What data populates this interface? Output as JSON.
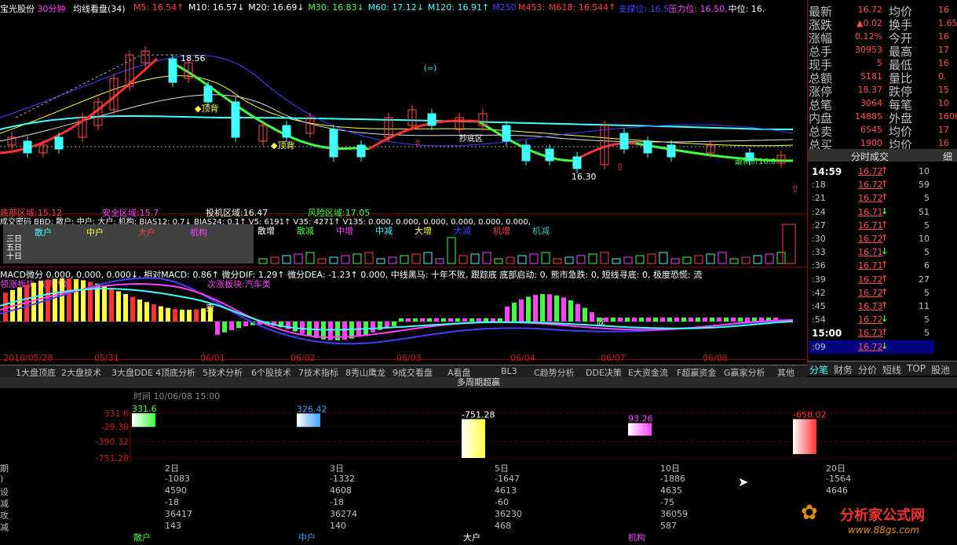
{
  "header": {
    "stock_name": "宝光股份",
    "period": "30分钟",
    "indicator": "均线看盘(34)",
    "ma_items": [
      {
        "label": "M5: 16.54↑",
        "color": "#ff4040"
      },
      {
        "label": "M10: 16.57↓",
        "color": "#ffffff"
      },
      {
        "label": "M20: 16.69↓",
        "color": "#ffffff"
      },
      {
        "label": "M30: 16.83↓",
        "color": "#40ff40"
      },
      {
        "label": "M60: 17.12↓",
        "color": "#40ffff"
      },
      {
        "label": "M120: 16.91↑",
        "color": "#40ffff"
      },
      {
        "label": "M250",
        "color": "#4040ff"
      },
      {
        "label": "M453:",
        "color": "#ff4040"
      },
      {
        "label": "M618: 16.544↑",
        "color": "#ff4040"
      },
      {
        "label": "支撑位: 16.5",
        "color": "#4040ff"
      },
      {
        "label": "压力位: 16.50,",
        "color": "#ff40ff"
      },
      {
        "label": "中位: 16.",
        "color": "#ffffff"
      }
    ]
  },
  "kline_annotations": {
    "high_price": "18.56",
    "low_price": "16.30",
    "top_divergence_1": "顶背",
    "top_divergence_2": "顶背",
    "sell_label": "抄底区",
    "cost_label": "最新价16.0",
    "bottom_zone": "底部区域:15.12",
    "safe_zone": "安全区域:15.7",
    "speculative_zone": "投机区域:16.47",
    "risk_zone": "风险区域:17.05"
  },
  "bbd": {
    "header": "成交密码 BBD: 散户: 中户: 大户: 机构: BIAS12: 0.7↓ BIAS24: 0.1↑ V5: 6191↑ V35: 4271↑ V135: 0.000, 0.000, 0.000, 0.000, 0.000, 0.000,",
    "legend": [
      "散户",
      "中户",
      "大户",
      "机构"
    ],
    "legend_colors": [
      "#40ffff",
      "#ffff40",
      "#ff4040",
      "#ff40ff"
    ],
    "periods": [
      "三日",
      "五日",
      "十日"
    ],
    "flow_labels": [
      "散增",
      "散减",
      "中增",
      "中减",
      "大增",
      "大减",
      "机增",
      "机减"
    ],
    "flow_colors": [
      "#ffffff",
      "#40ff40",
      "#ff40ff",
      "#40ffff",
      "#ffff40",
      "#4040ff",
      "#ff4040",
      "#40c0c0"
    ]
  },
  "macd": {
    "header": "MACD微分 0.000, 0.000, 0.000↓, 相对MACD: 0.86↑ 微分DIF: 1.29↑ 微分DEA: -1.23↑ 0.000, 中线黑马: 十年不败, 跟踪底 底部启动: 0, 熊市急跌: 0, 短线寻底: 0, 极度恐慌: 流",
    "strong_sector": "领涨板块:教育传媒",
    "second_sector": "次涨板块:汽车类",
    "sell_mark": "卖",
    "bottom_mark": "底"
  },
  "dates": [
    "2010/05/28",
    "05/31",
    "06/01",
    "06/02",
    "06/03",
    "06/04",
    "06/07",
    "06/08"
  ],
  "toolbar": [
    "1大盘顶底",
    "2大盘技术",
    "3大盘DDE",
    "4顶底分析",
    "5技术分析",
    "6个股技术",
    "7技术指标",
    "8秀山鹰龙",
    "9成交看盘",
    "A看盘",
    "BL3",
    "C趋势分析",
    "DDE决策",
    "E大资金流",
    "F超赢资金",
    "G赢家分析",
    "其他"
  ],
  "quote": {
    "rows": [
      {
        "l1": "最新",
        "v1": "16.72",
        "l2": "均价",
        "v2": "16"
      },
      {
        "l1": "涨跌",
        "v1": "▲0.02",
        "l2": "换手",
        "v2": "1.65"
      },
      {
        "l1": "涨幅",
        "v1": "0.12%",
        "l2": "今开",
        "v2": "16"
      },
      {
        "l1": "总手",
        "v1": "30953",
        "l2": "最高",
        "v2": "17"
      },
      {
        "l1": "现手",
        "v1": "5",
        "l2": "最低",
        "v2": "16"
      },
      {
        "l1": "总额",
        "v1": "5181",
        "l2": "量比",
        "v2": "0."
      },
      {
        "l1": "涨停",
        "v1": "18.37",
        "l2": "跌停",
        "v2": "15"
      },
      {
        "l1": "总笔",
        "v1": "3064",
        "l2": "每笔",
        "v2": "10"
      },
      {
        "l1": "内盘",
        "v1": "14885",
        "l2": "外盘",
        "v2": "1606"
      },
      {
        "l1": "总卖",
        "v1": "6545",
        "l2": "均价",
        "v2": "17"
      },
      {
        "l1": "总买",
        "v1": "1900",
        "l2": "均价",
        "v2": "16"
      }
    ],
    "ticks_title": "分时成交",
    "ticks_more": "细",
    "ticks": [
      {
        "t": "14:59",
        "p": "16.72",
        "v": "10",
        "a": "↑"
      },
      {
        "t": ":18",
        "p": "16.72",
        "v": "59",
        "a": "↑"
      },
      {
        "t": ":21",
        "p": "16.72",
        "v": "5",
        "a": "↑"
      },
      {
        "t": ":24",
        "p": "16.71",
        "v": "51",
        "a": "↓"
      },
      {
        "t": ":27",
        "p": "16.71",
        "v": "5",
        "a": "↑"
      },
      {
        "t": ":30",
        "p": "16.72",
        "v": "10",
        "a": "↑"
      },
      {
        "t": ":33",
        "p": "16.71",
        "v": "5",
        "a": "↓"
      },
      {
        "t": ":36",
        "p": "16.71",
        "v": "6",
        "a": "↑"
      },
      {
        "t": ":39",
        "p": "16.72",
        "v": "27",
        "a": "↑"
      },
      {
        "t": ":42",
        "p": "16.72",
        "v": "5",
        "a": "↑"
      },
      {
        "t": ":45",
        "p": "16.73",
        "v": "11",
        "a": "↑"
      },
      {
        "t": ":54",
        "p": "16.72",
        "v": "5",
        "a": "↓"
      },
      {
        "t": "15:00",
        "p": "16.73",
        "v": "5",
        "a": "↑"
      },
      {
        "t": ":09",
        "p": "16.72",
        "v": "",
        "a": "↓"
      }
    ],
    "tabs": [
      "分笔",
      "财务",
      "分价",
      "短线",
      "TOP",
      "股池"
    ]
  },
  "multi_period": {
    "title": "多周期超赢",
    "time_label": "时间 10/06/08 15:00",
    "y_ticks": [
      "331.6",
      "-29.38",
      "-390.32",
      "-751.28"
    ],
    "bars": [
      {
        "name": "散户",
        "value": "331.6",
        "color": "#40ff40"
      },
      {
        "name": "中户",
        "value": "326.42",
        "color": "#40a0ff"
      },
      {
        "name": "大户",
        "value": "-751.28",
        "color": "#ffff40"
      },
      {
        "name": "机构",
        "value": "93.26",
        "color": "#ff40ff"
      },
      {
        "name": "",
        "value": "-658.02",
        "color": "#ff3030"
      }
    ],
    "row_labels": [
      "期",
      ")",
      "设",
      "减",
      "攻",
      "减"
    ],
    "columns": [
      {
        "period": "2日",
        "vals": [
          "-1083",
          "4590",
          "-18",
          "36417",
          "143"
        ]
      },
      {
        "period": "3日",
        "vals": [
          "-1332",
          "4608",
          "-18",
          "36274",
          "140"
        ]
      },
      {
        "period": "5日",
        "vals": [
          "-1647",
          "4613",
          "-60",
          "36230",
          "468"
        ]
      },
      {
        "period": "10日",
        "vals": [
          "-1886",
          "4635",
          "-75",
          "36059",
          "587"
        ]
      },
      {
        "period": "20日",
        "vals": [
          "-1564",
          "4646",
          "",
          "",
          ""
        ]
      }
    ],
    "footer": [
      "散户",
      "中户",
      "大户",
      "机构"
    ],
    "footer_colors": [
      "#40ff40",
      "#40a0ff",
      "#ffffff",
      "#ff40ff"
    ]
  },
  "watermark": {
    "title": "分析家公式网",
    "url": "www.88gs.com"
  }
}
